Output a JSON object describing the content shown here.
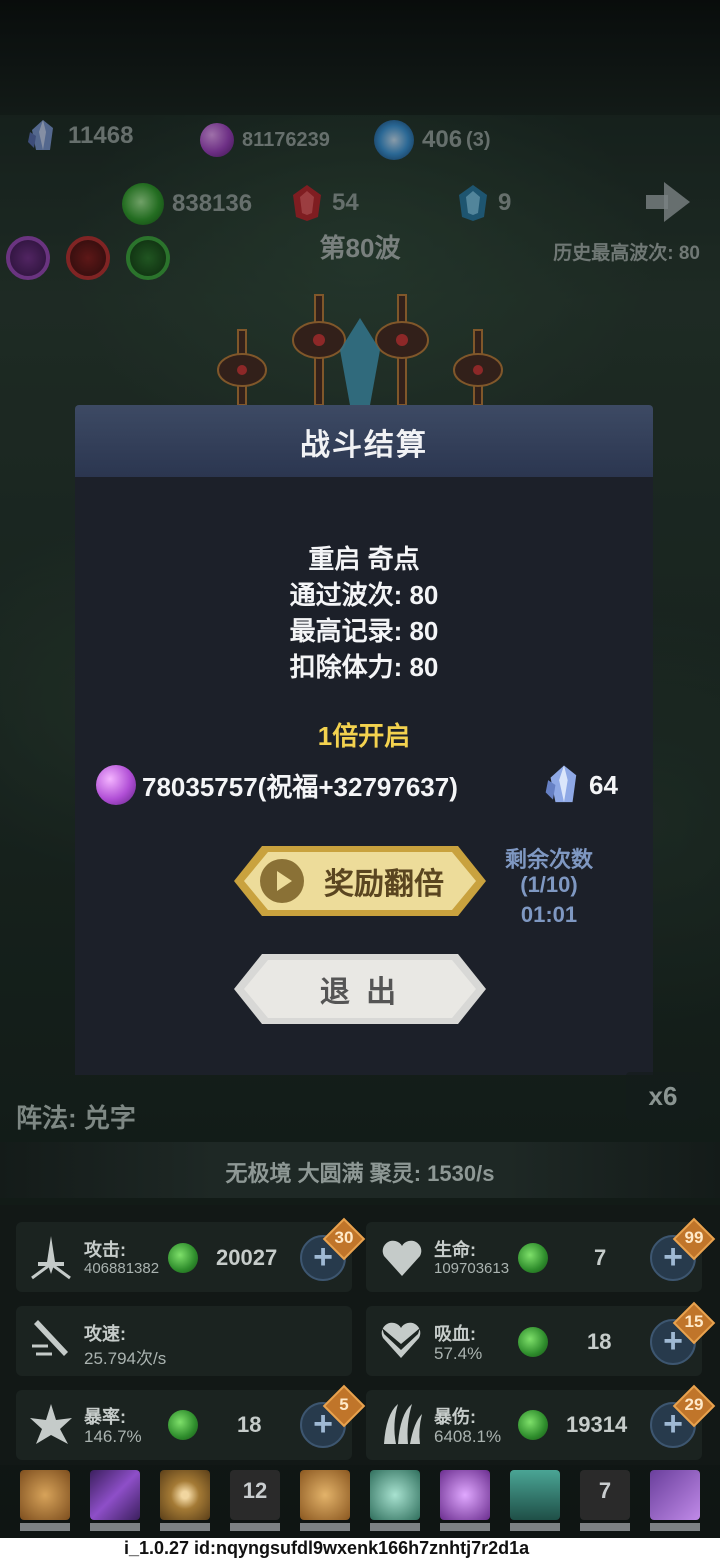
{
  "resources": {
    "crystal": "11468",
    "purple_orb": "81176239",
    "blue_flame": "406",
    "blue_flame_extra": "(3)",
    "green_essence": "838136",
    "red_gem": "54",
    "blue_gem": "9"
  },
  "wave": {
    "current": "第80波",
    "best_label": "历史最高波次:",
    "best_value": "80"
  },
  "modal": {
    "title": "战斗结算",
    "subtitle": "重启 奇点",
    "waves_line": "通过波次: 80",
    "record_line": "最高记录: 80",
    "stamina_line": "扣除体力: 80",
    "multiplier": "1倍开启",
    "orb_reward": "78035757(祝福+32797637)",
    "crystal_reward": "64",
    "double_button": "奖励翻倍",
    "remaining_label": "剩余次数",
    "remaining_count": "(1/10)",
    "remaining_timer": "01:01",
    "exit_button": "退 出"
  },
  "formation": "阵法: 兑字",
  "speed": "x6",
  "realm": "无极境 大圆满 聚灵: 1530/s",
  "stats": {
    "attack": {
      "label": "攻击:",
      "value": "406881382",
      "cost": "20027",
      "badge": "30"
    },
    "hp": {
      "label": "生命:",
      "value": "109703613",
      "cost": "7",
      "badge": "99"
    },
    "atk_speed": {
      "label": "攻速:",
      "value": "25.794次/s"
    },
    "lifesteal": {
      "label": "吸血:",
      "value": "57.4%",
      "cost": "18",
      "badge": "15"
    },
    "crit_rate": {
      "label": "暴率:",
      "value": "146.7%",
      "cost": "18",
      "badge": "5"
    },
    "crit_dmg": {
      "label": "暴伤:",
      "value": "6408.1%",
      "cost": "19314",
      "badge": "29"
    }
  },
  "skills": {
    "slot4": "12",
    "slot9": "7"
  },
  "colors": {
    "accent_gold": "#f3d24f",
    "remaining_blue": "#7f98c2",
    "badge_orange": "#c0752a"
  },
  "version": "i_1.0.27 id:nqyngsufdl9wxenk166h7znhtj7r2d1a"
}
